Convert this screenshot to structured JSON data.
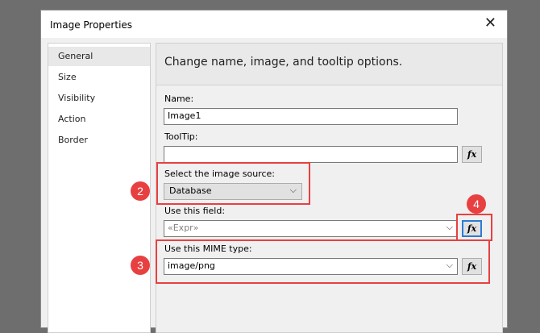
{
  "dialog": {
    "title": "Image Properties",
    "close_glyph": "✕"
  },
  "nav": {
    "items": [
      {
        "label": "General",
        "selected": true
      },
      {
        "label": "Size",
        "selected": false
      },
      {
        "label": "Visibility",
        "selected": false
      },
      {
        "label": "Action",
        "selected": false
      },
      {
        "label": "Border",
        "selected": false
      }
    ]
  },
  "content": {
    "header": "Change name, image, and tooltip options.",
    "name_label": "Name:",
    "name_value": "Image1",
    "tooltip_label": "ToolTip:",
    "tooltip_value": "",
    "source_label": "Select the image source:",
    "source_value": "Database",
    "field_label": "Use this field:",
    "field_value": "«Expr»",
    "mime_label": "Use this MIME type:",
    "mime_value": "image/png",
    "fx_label": "fx",
    "dropdown_glyph": "⌵"
  },
  "callouts": {
    "c2": "2",
    "c3": "3",
    "c4": "4",
    "color": "#e84040"
  }
}
